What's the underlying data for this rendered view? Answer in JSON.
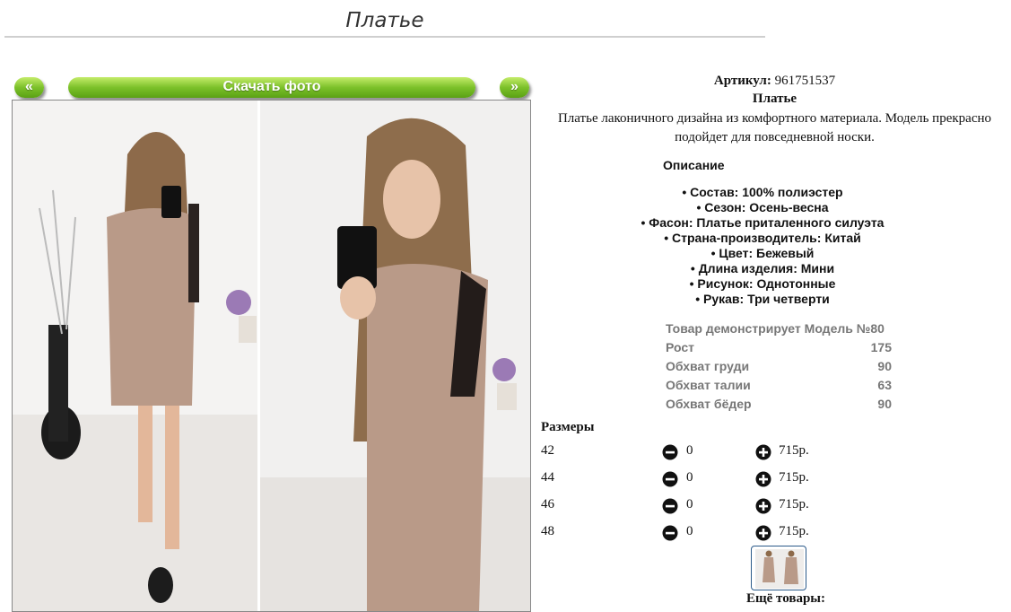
{
  "page": {
    "title": "Платье"
  },
  "gallery": {
    "prev_label": "«",
    "next_label": "»",
    "download_label": "Скачать фото"
  },
  "product": {
    "article_label": "Артикул:",
    "article_value": "961751537",
    "name": "Платье",
    "description": "Платье лаконичного дизайна из комфортного материала. Модель прекрасно подойдет для повседневной носки."
  },
  "properties": {
    "heading": "Описание",
    "items": [
      "• Состав: 100% полиэстер",
      "• Сезон: Осень-весна",
      "• Фасон: Платье приталенного силуэта",
      "• Страна-производитель: Китай",
      "• Цвет: Бежевый",
      "• Длина изделия: Мини",
      "• Рисунок: Однотонные",
      "• Рукав: Три четверти"
    ]
  },
  "model": {
    "heading": "Товар демонстрирует Модель №80",
    "rows": [
      {
        "label": "Рост",
        "value": "175"
      },
      {
        "label": "Обхват груди",
        "value": "90"
      },
      {
        "label": "Обхват талии",
        "value": "63"
      },
      {
        "label": "Обхват бёдер",
        "value": "90"
      }
    ]
  },
  "sizes": {
    "title": "Размеры",
    "rows": [
      {
        "size": "42",
        "qty": "0",
        "price": "715р."
      },
      {
        "size": "44",
        "qty": "0",
        "price": "715р."
      },
      {
        "size": "46",
        "qty": "0",
        "price": "715р."
      },
      {
        "size": "48",
        "qty": "0",
        "price": "715р."
      }
    ],
    "minus_icon": "minus-circle-icon",
    "plus_icon": "plus-circle-icon"
  },
  "more_goods_label": "Ещё товары:",
  "colors": {
    "button_green": "#6fb520",
    "dress_color": "#b99a88",
    "title_rule": "#cfcfcf"
  }
}
